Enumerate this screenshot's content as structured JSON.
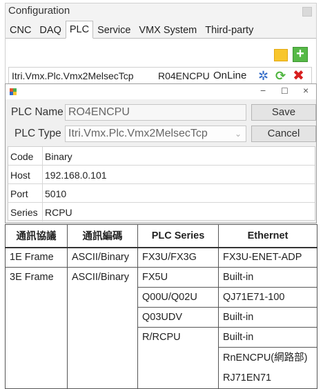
{
  "config_window": {
    "title": "Configuration",
    "tabs": [
      "CNC",
      "DAQ",
      "PLC",
      "Service",
      "VMX System",
      "Third-party"
    ],
    "active_tab": "PLC",
    "device": {
      "driver": "Itri.Vmx.Plc.Vmx2MelsecTcp",
      "model": "R04ENCPU",
      "status": "OnLine"
    }
  },
  "dialog": {
    "window_controls": {
      "minimize": "−",
      "maximize": "☐",
      "close": "×"
    },
    "plc_name_label": "PLC Name",
    "plc_name_value": "RO4ENCPU",
    "plc_type_label": "PLC Type",
    "plc_type_value": "Itri.Vmx.Plc.Vmx2MelsecTcp",
    "save_label": "Save",
    "cancel_label": "Cancel",
    "properties": [
      {
        "key": "Code",
        "value": "Binary"
      },
      {
        "key": "Host",
        "value": "192.168.0.101"
      },
      {
        "key": "Port",
        "value": "5010"
      },
      {
        "key": "Series",
        "value": "RCPU"
      }
    ]
  },
  "spec_table": {
    "headers": [
      "通訊協議",
      "通訊編碼",
      "PLC Series",
      "Ethernet"
    ],
    "rows": [
      [
        "1E Frame",
        "ASCII/Binary",
        "FX3U/FX3G",
        "FX3U-ENET-ADP"
      ],
      [
        "3E Frame",
        "ASCII/Binary",
        "FX5U",
        "Built-in"
      ],
      [
        "",
        "",
        "Q00U/Q02U",
        "QJ71E71-100"
      ],
      [
        "",
        "",
        "Q03UDV",
        "Built-in"
      ],
      [
        "",
        "",
        "R/RCPU",
        "Built-in"
      ]
    ],
    "last_ethernet_line1": "RnENCPU(網路部)",
    "last_ethernet_line2": "RJ71EN71"
  },
  "icons": {
    "folder": "folder-icon",
    "add": "add-icon",
    "settings": "gear-icon",
    "refresh": "refresh-icon",
    "delete": "delete-icon"
  },
  "colors": {
    "folder": "#f8c62d",
    "add": "#56b947",
    "gear": "#2f69c7",
    "refresh": "#4fb53f",
    "delete": "#d81f1f"
  }
}
